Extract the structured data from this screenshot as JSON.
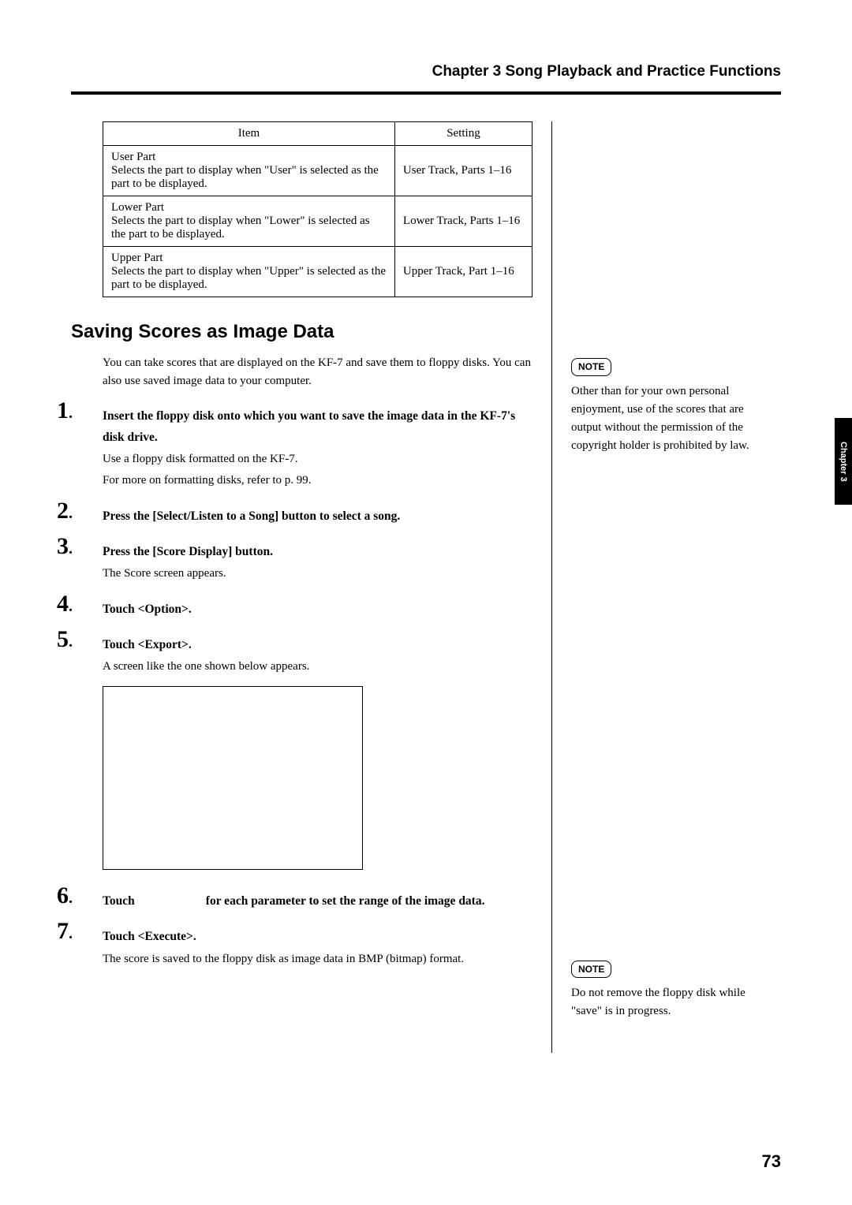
{
  "header": {
    "chapter_line": "Chapter 3 Song Playback and Practice Functions"
  },
  "table": {
    "col_item": "Item",
    "col_setting": "Setting",
    "rows": [
      {
        "title": "User Part",
        "desc": "Selects the part to display when \"User\" is selected as the part to be displayed.",
        "setting": "User Track, Parts 1–16"
      },
      {
        "title": "Lower Part",
        "desc": "Selects the part to display when \"Lower\" is selected as the part to be displayed.",
        "setting": "Lower Track, Parts 1–16"
      },
      {
        "title": "Upper Part",
        "desc": "Selects the part to display when \"Upper\" is selected as the part to be displayed.",
        "setting": "Upper Track, Part 1–16"
      }
    ]
  },
  "section": {
    "title": "Saving Scores as Image Data",
    "intro": "You can take scores that are displayed on the KF-7 and save them to floppy disks. You can also use saved image data to your computer."
  },
  "steps": [
    {
      "num": "1",
      "bold": "Insert the floppy disk onto which you want to save the image data in the KF-7's disk drive.",
      "lines": [
        "Use a floppy disk formatted on the KF-7.",
        "For more on formatting disks, refer to p. 99."
      ]
    },
    {
      "num": "2",
      "bold": "Press the [Select/Listen to a Song] button to select a song.",
      "lines": []
    },
    {
      "num": "3",
      "bold": "Press the [Score Display] button.",
      "lines": [
        "The Score screen appears."
      ]
    },
    {
      "num": "4",
      "bold": "Touch <Option>.",
      "lines": []
    },
    {
      "num": "5",
      "bold": "Touch <Export>.",
      "lines": [
        "A screen like the one shown below appears."
      ]
    },
    {
      "num": "6",
      "bold_prefix": "Touch",
      "bold_suffix": "for each parameter to set the range of the image data.",
      "lines": []
    },
    {
      "num": "7",
      "bold": "Touch <Execute>.",
      "lines": [
        "The score is saved to the floppy disk as image data in BMP (bitmap) format."
      ]
    }
  ],
  "sidebar": {
    "note_label": "NOTE",
    "note1": "Other than for your own personal enjoyment, use of the scores that are output without the permission of the copyright holder is prohibited by law.",
    "note2": "Do not remove the floppy disk while \"save\" is in progress."
  },
  "tab": "Chapter 3",
  "page_number": "73"
}
